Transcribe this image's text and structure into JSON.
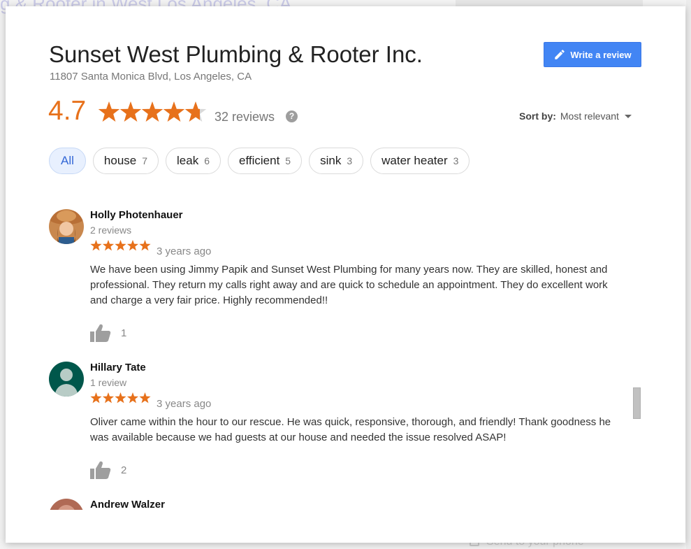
{
  "background": {
    "title": "g & Rooter in West Los Angeles, CA",
    "footer_link": "Send to your phone"
  },
  "business": {
    "name": "Sunset West Plumbing & Rooter Inc.",
    "address": "11807 Santa Monica Blvd, Los Angeles, CA",
    "rating": "4.7",
    "rating_value": 4.7,
    "review_count": "32 reviews",
    "help_symbol": "?"
  },
  "write_review": {
    "label": "Write a review",
    "icon": "pencil-icon"
  },
  "sort": {
    "label": "Sort by:",
    "value": "Most relevant"
  },
  "filters": [
    {
      "label": "All",
      "count": "",
      "active": true
    },
    {
      "label": "house",
      "count": "7",
      "active": false
    },
    {
      "label": "leak",
      "count": "6",
      "active": false
    },
    {
      "label": "efficient",
      "count": "5",
      "active": false
    },
    {
      "label": "sink",
      "count": "3",
      "active": false
    },
    {
      "label": "water heater",
      "count": "3",
      "active": false
    }
  ],
  "reviews": [
    {
      "name": "Holly Photenhauer",
      "sub": "2 reviews",
      "stars": 5,
      "time": "3 years ago",
      "text": "We have been using Jimmy Papik and Sunset West Plumbing for many years now.  They are skilled, honest and professional.  They return my calls right away and are quick to schedule an appointment.  They do excellent work and charge a very fair price.  Highly recommended!!",
      "likes": "1"
    },
    {
      "name": "Hillary Tate",
      "sub": "1 review",
      "stars": 5,
      "time": "3 years ago",
      "text": "Oliver came within the hour to our rescue.  He was quick, responsive, thorough, and friendly!  Thank goodness he was available because we had guests at our house and needed the issue resolved ASAP!",
      "likes": "2"
    },
    {
      "name": "Andrew Walzer"
    }
  ],
  "colors": {
    "star": "#e7711b",
    "accent": "#4285f4",
    "chip_active_bg": "#e8f0fe"
  }
}
